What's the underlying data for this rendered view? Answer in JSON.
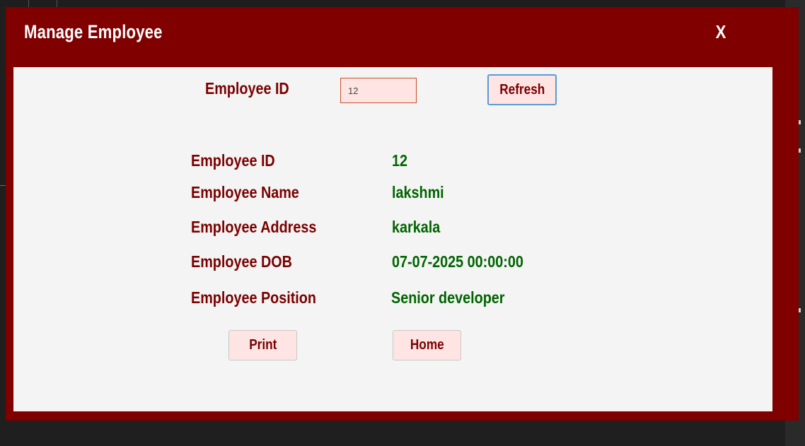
{
  "window": {
    "title": "Manage Employee",
    "close_label": "X"
  },
  "search": {
    "label": "Employee ID",
    "value": "12",
    "refresh_label": "Refresh"
  },
  "details": [
    {
      "label": "Employee ID",
      "value": "12"
    },
    {
      "label": "Employee Name",
      "value": "lakshmi"
    },
    {
      "label": "Employee Address",
      "value": "karkala"
    },
    {
      "label": "Employee DOB",
      "value": "07-07-2025 00:00:00"
    },
    {
      "label": "Employee Position",
      "value": "Senior developer"
    }
  ],
  "actions": {
    "print_label": "Print",
    "home_label": "Home"
  },
  "colors": {
    "header": "#800000",
    "label_text": "#7a0000",
    "value_text": "#006400",
    "panel": "#f4f4f4",
    "button_bg": "#ffe4e4"
  }
}
